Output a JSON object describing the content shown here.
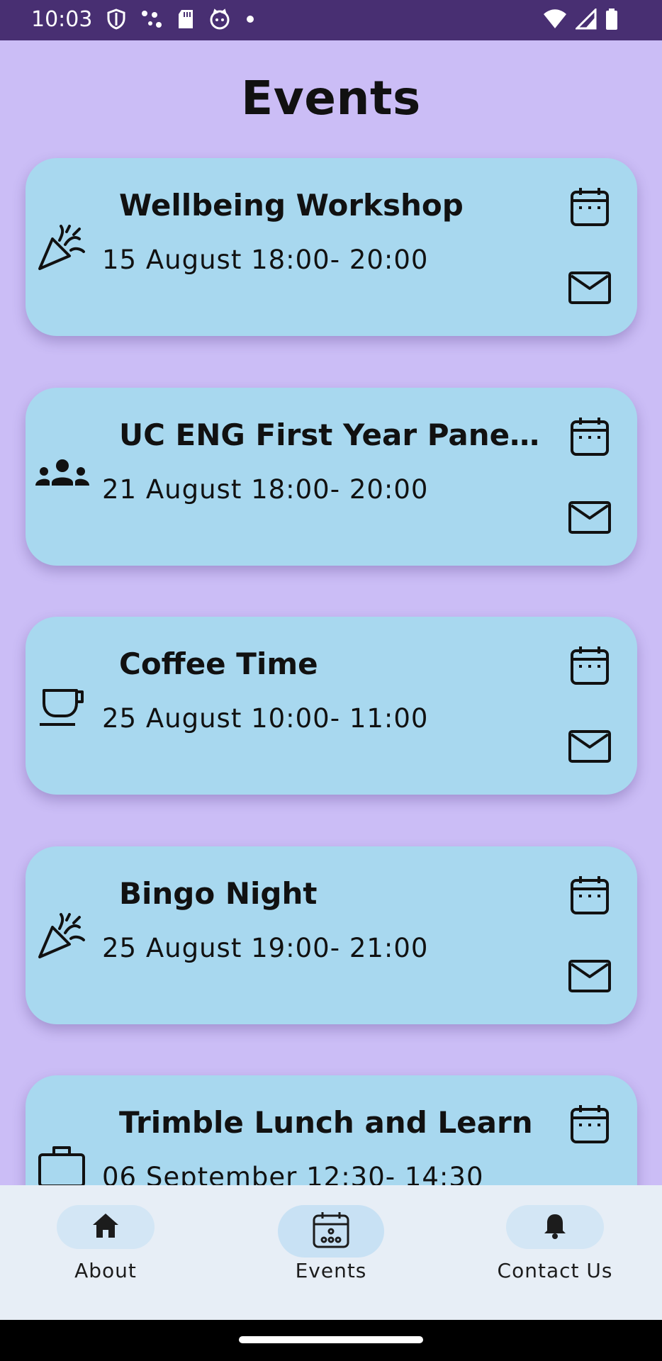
{
  "status_bar": {
    "time": "10:03",
    "icons_left": [
      "shield-icon",
      "nodes-icon",
      "sd-card-icon",
      "cat-face-icon",
      "dot-icon"
    ],
    "icons_right": [
      "wifi-icon",
      "signal-icon",
      "battery-icon"
    ]
  },
  "page": {
    "title": "Events"
  },
  "events": [
    {
      "title": "Wellbeing Workshop",
      "time": "15 August 18:00- 20:00",
      "icon": "party-popper-icon"
    },
    {
      "title": "UC ENG First Year Panel Night",
      "time": "21 August 18:00- 20:00",
      "icon": "groups-icon"
    },
    {
      "title": "Coffee Time",
      "time": "25 August 10:00- 11:00",
      "icon": "coffee-cup-icon"
    },
    {
      "title": "Bingo Night",
      "time": "25 August 19:00- 21:00",
      "icon": "party-popper-icon"
    },
    {
      "title": "Trimble Lunch and Learn",
      "time": "06 September 12:30- 14:30",
      "icon": "briefcase-icon"
    }
  ],
  "card_actions": {
    "calendar_icon": "calendar-icon",
    "mail_icon": "mail-icon"
  },
  "bottom_nav": {
    "items": [
      {
        "label": "About",
        "icon": "home-icon",
        "active": false
      },
      {
        "label": "Events",
        "icon": "calendar-dots-icon",
        "active": true
      },
      {
        "label": "Contact Us",
        "icon": "bell-icon",
        "active": false
      }
    ]
  },
  "colors": {
    "background": "#cbbdf6",
    "status_bar": "#482f72",
    "card": "#a8d8ef",
    "nav_background": "#e7eef6",
    "nav_pill": "#d3e6f5"
  }
}
